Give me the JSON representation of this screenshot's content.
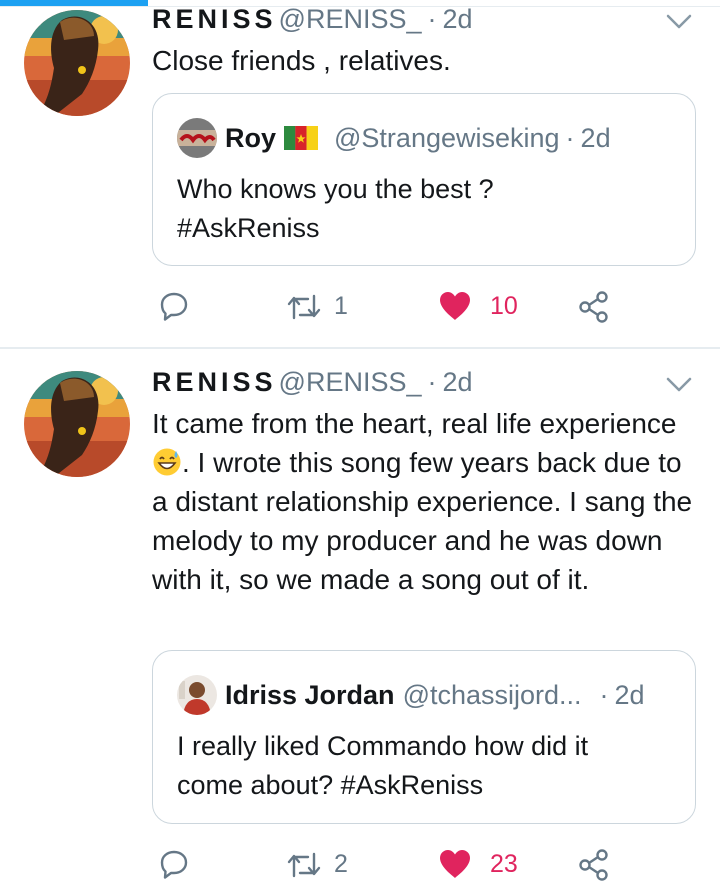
{
  "tweets": [
    {
      "author": {
        "display_name": "RENISS",
        "handle": "@RENISS_",
        "time": "2d",
        "avatar": "reniss-avatar"
      },
      "text": "Close friends , relatives.",
      "quoted": {
        "author": {
          "display_name": "Roy",
          "flag": "cameroon-flag",
          "handle": "@Strangewiseking",
          "time": "2d"
        },
        "text_lines": [
          "Who knows you the best ?",
          "#AskReniss"
        ]
      },
      "stats": {
        "retweets": "1",
        "likes": "10",
        "liked": true
      }
    },
    {
      "author": {
        "display_name": "RENISS",
        "handle": "@RENISS_",
        "time": "2d",
        "avatar": "reniss-avatar"
      },
      "text_before_emoji": "It came from the heart, real life experience",
      "emoji": "grinning-sweat-emoji",
      "text_after_emoji": ". I wrote this song few years back due to a distant relationship experience. I sang the melody to my producer and he was down with it, so we made a song out of it.",
      "quoted": {
        "author": {
          "display_name": "Idriss Jordan",
          "handle": "@tchassijord...",
          "time": "2d"
        },
        "text_lines": [
          "I really liked Commando how did it",
          "come about?  #AskReniss"
        ]
      },
      "stats": {
        "retweets": "2",
        "likes": "23",
        "liked": true
      }
    }
  ],
  "colors": {
    "accent": "#1da1f2",
    "like": "#e0245e",
    "secondary_text": "#657786",
    "border": "#ccd6dd",
    "divider": "#e6ecf0"
  },
  "icons": {
    "reply": "reply-icon",
    "retweet": "retweet-icon",
    "like": "heart-icon",
    "share": "share-icon",
    "more": "chevron-down-icon"
  }
}
